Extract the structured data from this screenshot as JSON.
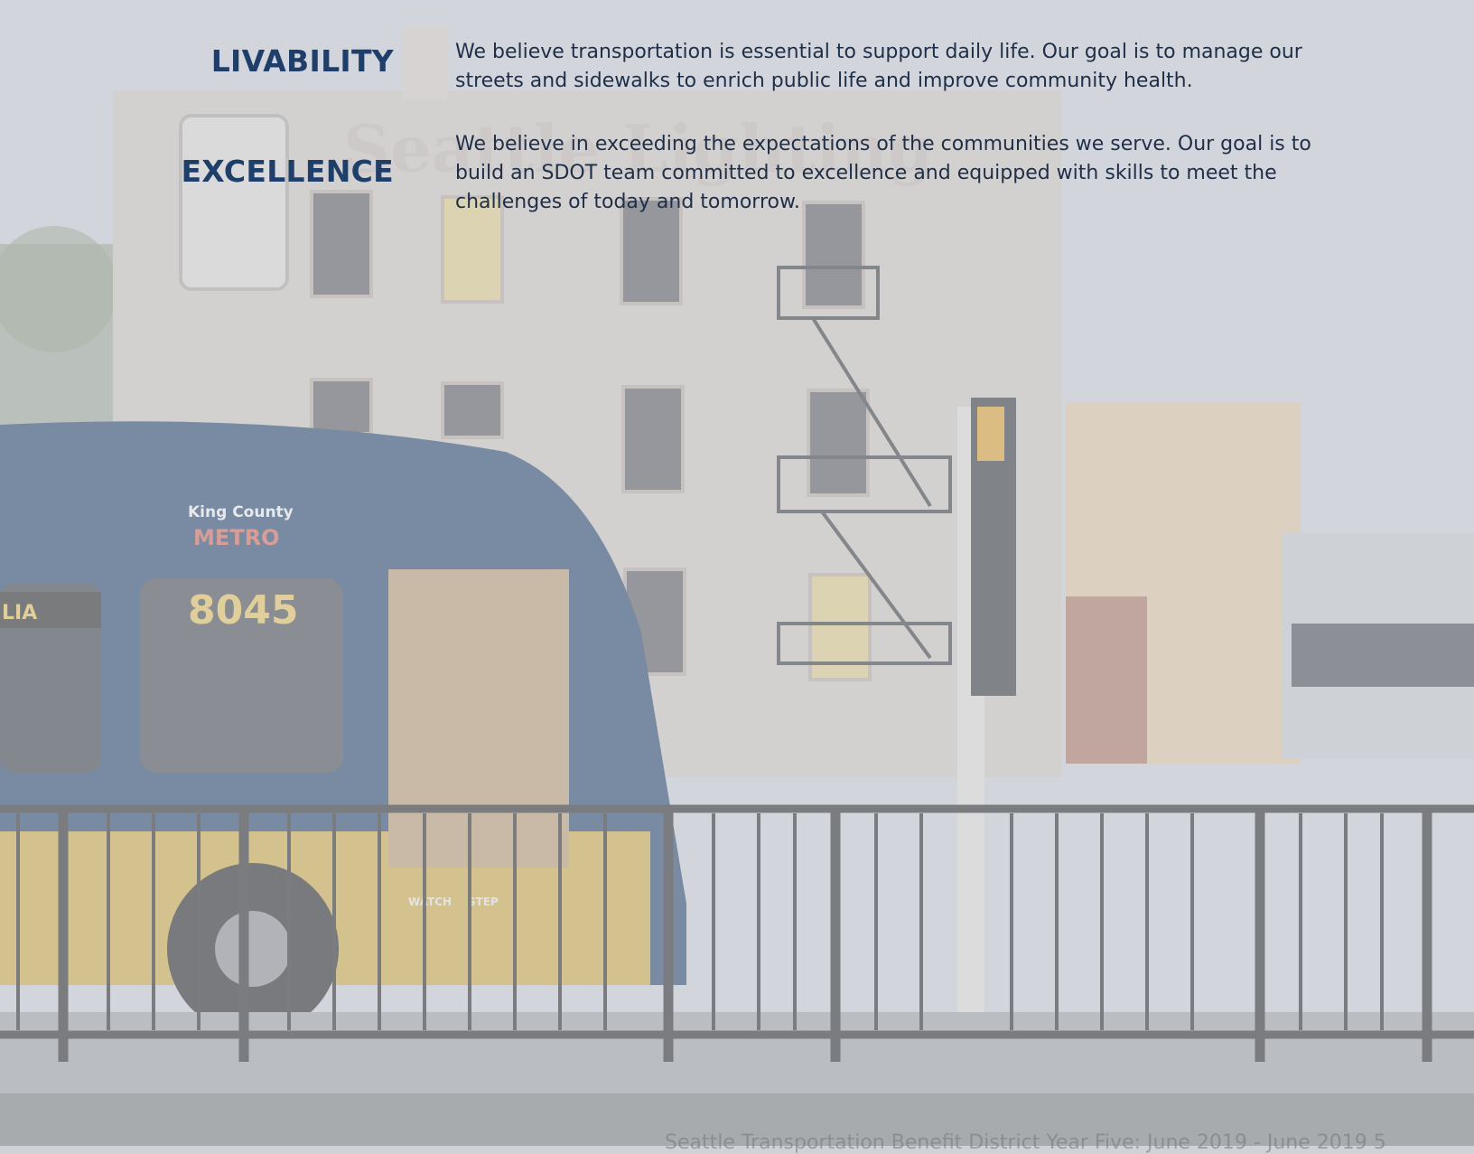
{
  "values": [
    {
      "title": "LIVABILITY",
      "text": "We believe transportation is essential to support daily life. Our goal is to manage our streets and sidewalks to enrich public life and improve community health."
    },
    {
      "title": "EXCELLENCE",
      "text": "We believe in exceeding the expectations of the communities we serve. Our goal is to build an SDOT team committed to excellence and equipped with skills to meet the challenges of today and tomorrow."
    }
  ],
  "photo": {
    "bus_brand": "King County",
    "bus_brand_sub": "METRO",
    "bus_number": "8045",
    "bus_sign_fragment": "LIA",
    "building_sign": "Seattle Lighting",
    "step_warning_left": "WATCH",
    "step_warning_right": "STEP"
  },
  "footer": {
    "text": "Seattle Transportation Benefit District Year Five: June 2019 - June 2019 5"
  },
  "colors": {
    "heading": "#1f3f6b",
    "body_text": "#1f2f48",
    "bus_blue": "#2c4a6e",
    "bus_yellow": "#c9a94a"
  }
}
